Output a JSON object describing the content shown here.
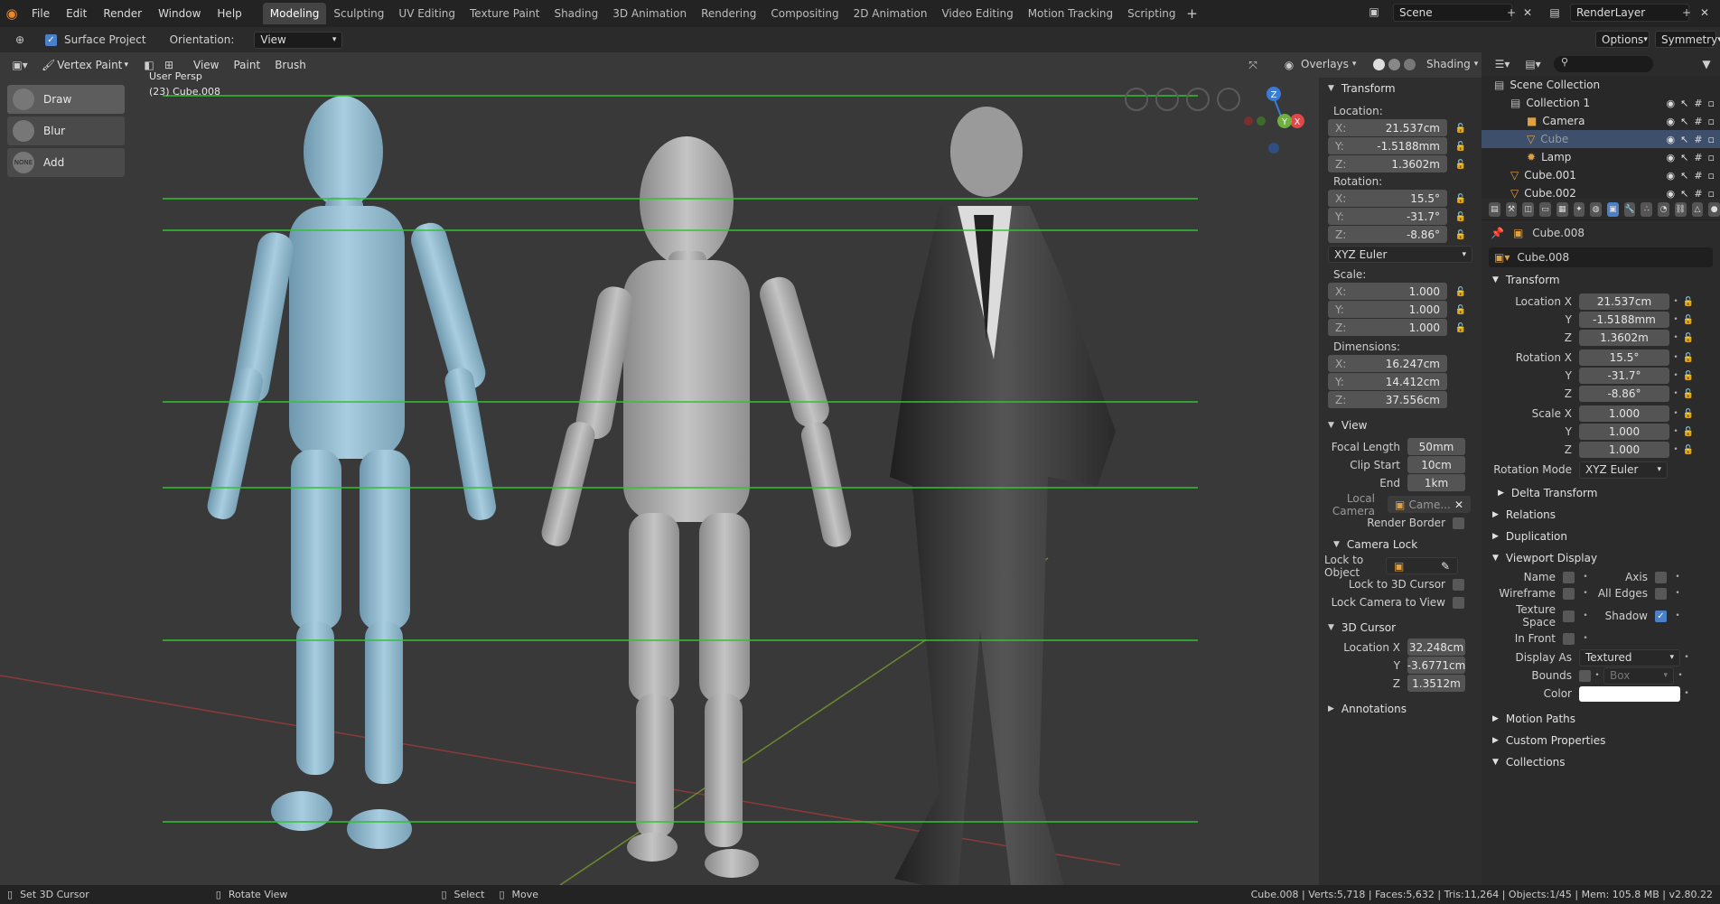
{
  "menu": [
    "File",
    "Edit",
    "Render",
    "Window",
    "Help"
  ],
  "workspaces": [
    {
      "label": "Modeling",
      "active": true
    },
    {
      "label": "Sculpting"
    },
    {
      "label": "UV Editing"
    },
    {
      "label": "Texture Paint"
    },
    {
      "label": "Shading"
    },
    {
      "label": "3D Animation"
    },
    {
      "label": "Rendering"
    },
    {
      "label": "Compositing"
    },
    {
      "label": "2D Animation"
    },
    {
      "label": "Video Editing"
    },
    {
      "label": "Motion Tracking"
    },
    {
      "label": "Scripting"
    }
  ],
  "scene": {
    "name": "Scene"
  },
  "render_layer": {
    "name": "RenderLayer"
  },
  "toolheader": {
    "surface_project": "Surface Project",
    "orientation_label": "Orientation:",
    "orientation_value": "View",
    "options": "Options",
    "symmetry": "Symmetry"
  },
  "viewport": {
    "mode": "Vertex Paint",
    "menus": [
      "View",
      "Paint",
      "Brush"
    ],
    "persp_label": "User Persp",
    "object_label": "(23) Cube.008",
    "overlays": "Overlays",
    "shading": "Shading",
    "tools": [
      {
        "label": "Draw",
        "active": true
      },
      {
        "label": "Blur"
      },
      {
        "label": "Add",
        "icon_text": "NONE"
      }
    ],
    "gizmo": {
      "z": "Z",
      "x": "X",
      "y": "Y"
    }
  },
  "npanel": {
    "transform_title": "Transform",
    "location_label": "Location:",
    "location": [
      {
        "axis": "X:",
        "value": "21.537cm"
      },
      {
        "axis": "Y:",
        "value": "-1.5188mm"
      },
      {
        "axis": "Z:",
        "value": "1.3602m"
      }
    ],
    "rotation_label": "Rotation:",
    "rotation": [
      {
        "axis": "X:",
        "value": "15.5°"
      },
      {
        "axis": "Y:",
        "value": "-31.7°"
      },
      {
        "axis": "Z:",
        "value": "-8.86°"
      }
    ],
    "rotation_mode": "XYZ Euler",
    "scale_label": "Scale:",
    "scale": [
      {
        "axis": "X:",
        "value": "1.000"
      },
      {
        "axis": "Y:",
        "value": "1.000"
      },
      {
        "axis": "Z:",
        "value": "1.000"
      }
    ],
    "dimensions_label": "Dimensions:",
    "dimensions": [
      {
        "axis": "X:",
        "value": "16.247cm"
      },
      {
        "axis": "Y:",
        "value": "14.412cm"
      },
      {
        "axis": "Z:",
        "value": "37.556cm"
      }
    ],
    "view_title": "View",
    "focal_length_label": "Focal Length",
    "focal_length": "50mm",
    "clip_start_label": "Clip Start",
    "clip_start": "10cm",
    "end_label": "End",
    "end": "1km",
    "local_camera_label": "Local Camera",
    "local_camera": "Came...",
    "render_border_label": "Render Border",
    "camera_lock_title": "Camera Lock",
    "lock_to_object_label": "Lock to Object",
    "lock_to_3d_cursor_label": "Lock to 3D Cursor",
    "lock_camera_to_view_label": "Lock Camera to View",
    "cursor_title": "3D Cursor",
    "cursor": [
      {
        "axis": "Location X",
        "value": "32.248cm"
      },
      {
        "axis": "Y",
        "value": "-3.6771cm"
      },
      {
        "axis": "Z",
        "value": "1.3512m"
      }
    ],
    "annotations_title": "Annotations"
  },
  "outliner": {
    "rows": [
      {
        "label": "Scene Collection",
        "indent": 0,
        "icon": "scene-collection-icon"
      },
      {
        "label": "Collection 1",
        "indent": 1,
        "icon": "collection-icon"
      },
      {
        "label": "Camera",
        "indent": 2,
        "icon": "camera-icon"
      },
      {
        "label": "Cube",
        "indent": 2,
        "icon": "mesh-icon",
        "selected": true
      },
      {
        "label": "Lamp",
        "indent": 2,
        "icon": "lamp-icon"
      },
      {
        "label": "Cube.001",
        "indent": 1,
        "icon": "mesh-icon"
      },
      {
        "label": "Cube.002",
        "indent": 1,
        "icon": "mesh-icon"
      }
    ]
  },
  "properties": {
    "object_name": "Cube.008",
    "object_field": "Cube.008",
    "transform_title": "Transform",
    "location": [
      {
        "label": "Location X",
        "value": "21.537cm"
      },
      {
        "label": "Y",
        "value": "-1.5188mm"
      },
      {
        "label": "Z",
        "value": "1.3602m"
      }
    ],
    "rotation": [
      {
        "label": "Rotation X",
        "value": "15.5°"
      },
      {
        "label": "Y",
        "value": "-31.7°"
      },
      {
        "label": "Z",
        "value": "-8.86°"
      }
    ],
    "scale": [
      {
        "label": "Scale X",
        "value": "1.000"
      },
      {
        "label": "Y",
        "value": "1.000"
      },
      {
        "label": "Z",
        "value": "1.000"
      }
    ],
    "rotation_mode_label": "Rotation Mode",
    "rotation_mode": "XYZ Euler",
    "delta_transform": "Delta Transform",
    "relations": "Relations",
    "duplication": "Duplication",
    "viewport_display": "Viewport Display",
    "vd_name": "Name",
    "vd_axis": "Axis",
    "vd_wireframe": "Wireframe",
    "vd_all_edges": "All Edges",
    "vd_texture_space": "Texture Space",
    "vd_shadow": "Shadow",
    "vd_in_front": "In Front",
    "display_as_label": "Display As",
    "display_as": "Textured",
    "bounds_label": "Bounds",
    "bounds_value": "Box",
    "color_label": "Color",
    "motion_paths": "Motion Paths",
    "custom_properties": "Custom Properties",
    "collections": "Collections"
  },
  "statusbar": {
    "set_cursor": "Set 3D Cursor",
    "rotate_view": "Rotate View",
    "select": "Select",
    "move": "Move",
    "stats": "Cube.008 | Verts:5,718 | Faces:5,632 | Tris:11,264 | Objects:1/45 | Mem: 105.8 MB | v2.80.22"
  },
  "colors": {
    "accent": "#4b7fc8",
    "active_tab": "#444444",
    "grid_green": "#2fc42f"
  }
}
